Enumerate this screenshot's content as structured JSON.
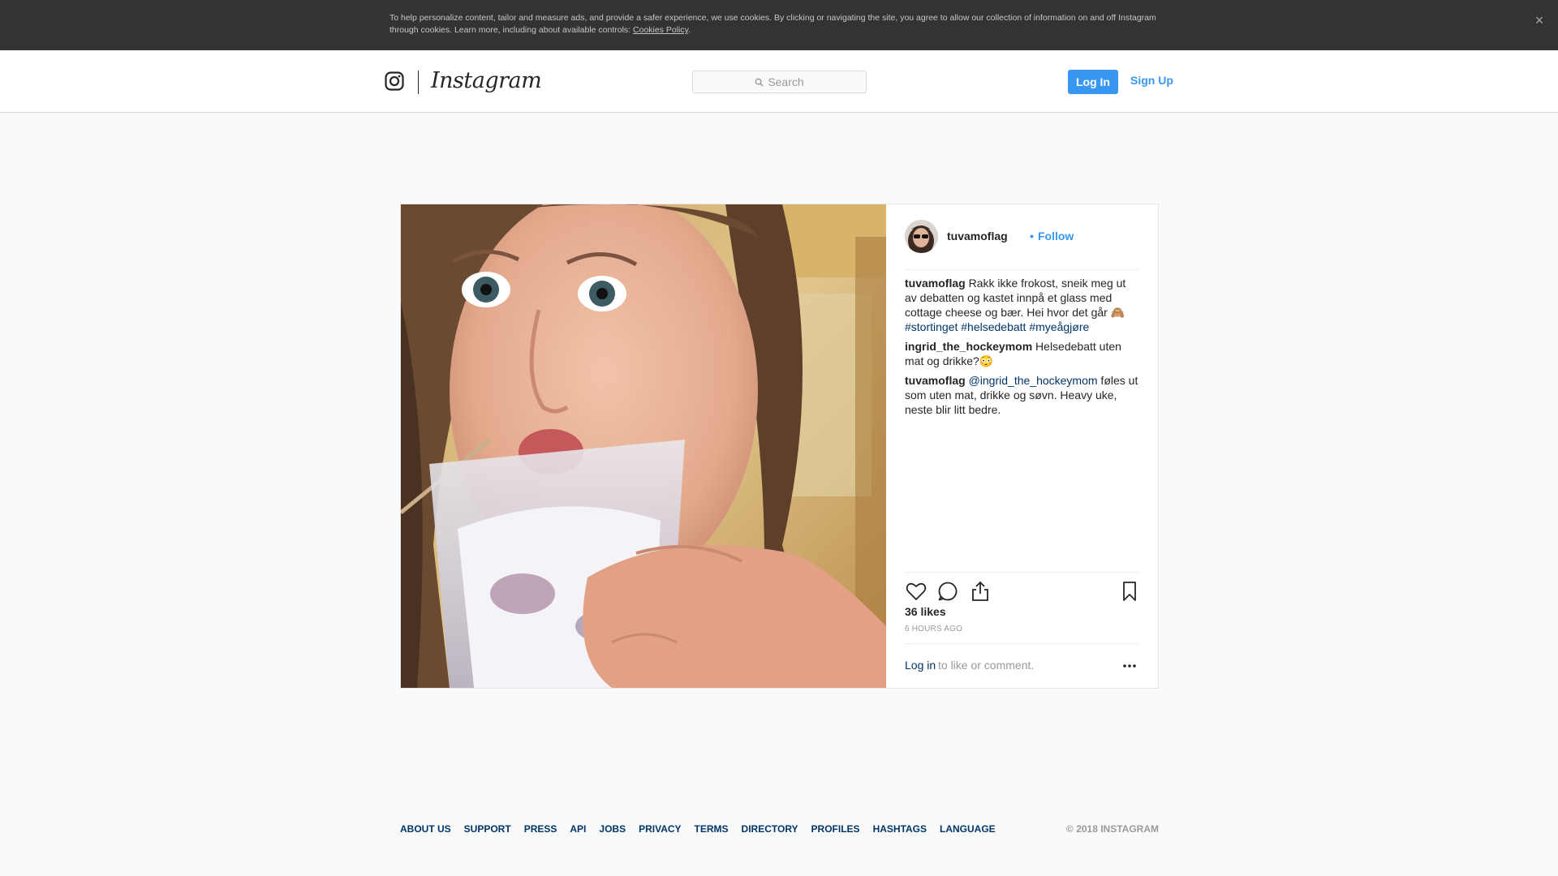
{
  "cookie_banner": {
    "text": "To help personalize content, tailor and measure ads, and provide a safer experience, we use cookies. By clicking or navigating the site, you agree to allow our collection of information on and off Instagram through cookies. Learn more, including about available controls: ",
    "policy_link": "Cookies Policy",
    "period": ".",
    "close_glyph": "×"
  },
  "header": {
    "logo_text": "Instagram",
    "search_placeholder": "Search",
    "login_label": "Log In",
    "signup_label": "Sign Up",
    "accent_color": "#3897f0"
  },
  "post": {
    "username": "tuvamoflag",
    "dot": "•",
    "follow_label": "Follow",
    "comments": [
      {
        "user": "tuvamoflag",
        "text": " Rakk ikke frokost, sneik meg ut av debatten og kastet innpå et glass med cottage cheese og bær. Hei hvor det går 🙈 ",
        "tags": [
          "#stortinget",
          "#helsedebatt",
          "#myeågjøre"
        ]
      },
      {
        "user": "ingrid_the_hockeymom",
        "text": " Helsedebatt uten mat og drikke?😳"
      },
      {
        "user": "tuvamoflag",
        "mention": "@ingrid_the_hockeymom",
        "text": " føles ut som uten mat, drikke og søvn. Heavy uke, neste blir litt bedre."
      }
    ],
    "icons": [
      "heart-icon",
      "comment-icon",
      "share-icon",
      "bookmark-icon",
      "more-options-icon"
    ],
    "likes": "36 likes",
    "time_ago": "6 HOURS AGO",
    "login_link": "Log in",
    "login_rest": " to like or comment."
  },
  "footer": {
    "links": [
      "About us",
      "Support",
      "Press",
      "API",
      "Jobs",
      "Privacy",
      "Terms",
      "Directory",
      "Profiles",
      "Hashtags",
      "Language"
    ],
    "copyright": "© 2018 Instagram"
  }
}
